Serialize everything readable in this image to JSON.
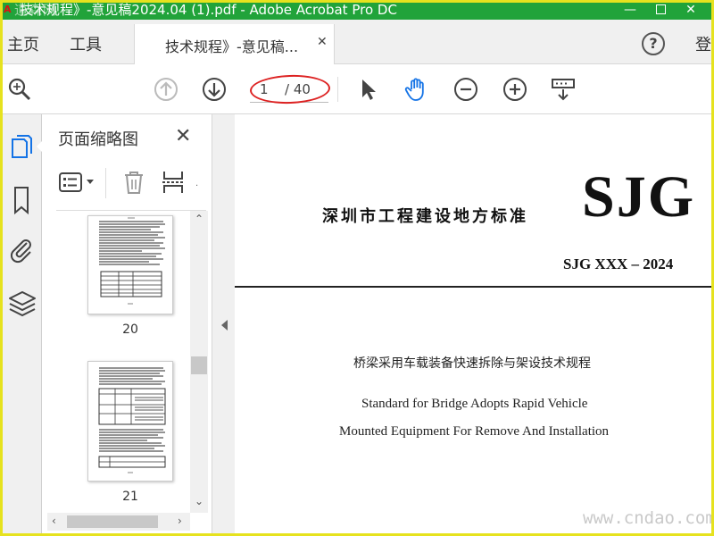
{
  "window": {
    "title": "技术规程》-意见稿2024.04 (1).pdf - Adobe Acrobat Pro DC",
    "watermark_logo": "道森网",
    "minimize": "—",
    "close": "✕"
  },
  "tabs": {
    "home": "主页",
    "tools": "工具",
    "document": "技术规程》-意见稿...",
    "document_close": "✕",
    "help": "?",
    "login": "登"
  },
  "toolbar": {
    "current_page": "1",
    "total_pages": "/ 40",
    "icons": [
      "zoom-search-icon",
      "page-up-icon",
      "page-down-icon",
      "select-arrow-icon",
      "hand-tool-icon",
      "zoom-out-icon",
      "zoom-in-icon",
      "scroll-mode-icon"
    ],
    "accent": "#1473e6",
    "highlight_color": "#d22222"
  },
  "rail": {
    "icons": [
      "page-thumbnails-icon",
      "bookmark-icon",
      "attachment-icon",
      "layers-icon"
    ]
  },
  "thumbnail_panel": {
    "title": "页面缩略图",
    "close": "✕",
    "pages": [
      {
        "number": "20"
      },
      {
        "number": "21"
      }
    ]
  },
  "document": {
    "standard_label": "深圳市工程建设地方标准",
    "logo": "SJG",
    "code": "SJG XXX – 2024",
    "title_cn": "桥梁采用车载装备快速拆除与架设技术规程",
    "title_en_line1": "Standard for Bridge Adopts Rapid Vehicle",
    "title_en_line2": "Mounted Equipment For Remove And Installation",
    "site_watermark": "www.cndao.com"
  }
}
